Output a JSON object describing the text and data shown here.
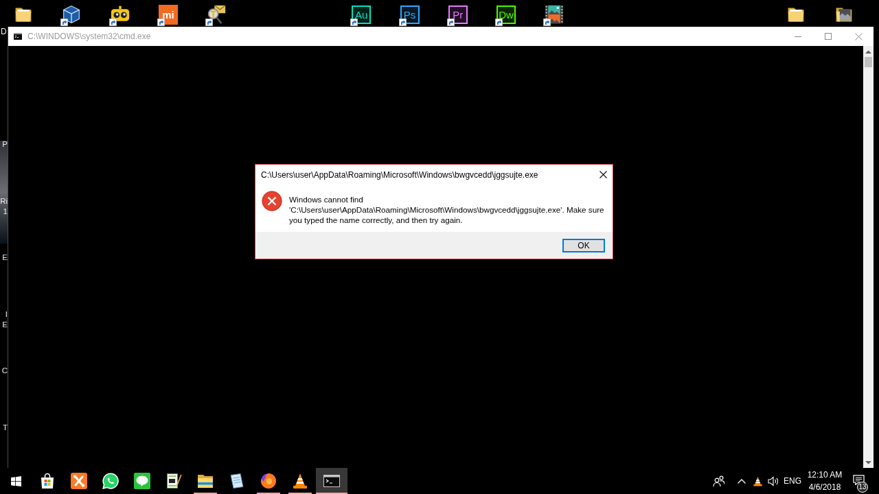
{
  "desktop_icons": [
    {
      "kind": "folder",
      "shortcut": false,
      "label": "D"
    },
    {
      "kind": "cube",
      "shortcut": true
    },
    {
      "kind": "robot",
      "shortcut": true
    },
    {
      "kind": "solid-tile",
      "text": "mi",
      "shortcut": true
    },
    {
      "kind": "magnifier",
      "shortcut": true
    },
    {
      "kind": "tile",
      "text": "Au",
      "color": "#00e4bb",
      "shortcut": true
    },
    {
      "kind": "tile",
      "text": "Ps",
      "color": "#31a8ff",
      "shortcut": true
    },
    {
      "kind": "tile",
      "text": "Pr",
      "color": "#e77cff",
      "shortcut": true
    },
    {
      "kind": "tile",
      "text": "Dw",
      "color": "#4cf700",
      "shortcut": true
    },
    {
      "kind": "film",
      "shortcut": true
    },
    {
      "kind": "folder",
      "shortcut": false
    },
    {
      "kind": "photo-folder",
      "shortcut": false
    }
  ],
  "desktop_left_labels": [
    {
      "lines": [
        "P"
      ]
    },
    {
      "lines": [
        "Ri",
        "1"
      ]
    },
    {
      "lines": [
        "E"
      ]
    },
    {
      "lines": [
        "I",
        "E"
      ]
    },
    {
      "lines": [
        "C"
      ]
    },
    {
      "lines": [
        "T"
      ]
    }
  ],
  "console_window": {
    "title": "C:\\WINDOWS\\system32\\cmd.exe",
    "active": false
  },
  "dialog": {
    "kind": "error",
    "title": "C:\\Users\\user\\AppData\\Roaming\\Microsoft\\Windows\\bwgvcedd\\jggsujte.exe",
    "message": "Windows cannot find 'C:\\Users\\user\\AppData\\Roaming\\Microsoft\\Windows\\bwgvcedd\\jggsujte.exe'. Make sure you typed the name correctly, and then try again.",
    "buttons": [
      {
        "label": "OK",
        "focused": true
      }
    ]
  },
  "taskbar": {
    "apps": [
      {
        "kind": "store",
        "running": false,
        "selected": false
      },
      {
        "kind": "cross-tile",
        "running": false,
        "selected": false
      },
      {
        "kind": "chat",
        "running": false,
        "selected": false
      },
      {
        "kind": "messenger",
        "running": false,
        "selected": false
      },
      {
        "kind": "editor",
        "running": false,
        "selected": false
      },
      {
        "kind": "folder",
        "running": true,
        "selected": false
      },
      {
        "kind": "notepad",
        "running": false,
        "selected": false
      },
      {
        "kind": "browser",
        "running": true,
        "selected": false
      },
      {
        "kind": "cone",
        "running": true,
        "selected": false
      },
      {
        "kind": "console",
        "running": true,
        "selected": true
      }
    ],
    "tray": {
      "icons": [
        {
          "kind": "cone"
        }
      ],
      "language": "ENG",
      "time": "12:10 AM",
      "date": "4/6/2018",
      "notifications": "13"
    }
  }
}
